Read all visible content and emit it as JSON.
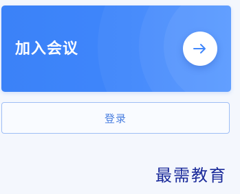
{
  "join_card": {
    "title": "加入会议",
    "arrow_icon": "arrow-right-icon",
    "colors": {
      "background": "#3f86fb",
      "text": "#ffffff"
    }
  },
  "login": {
    "label": "登录",
    "colors": {
      "border": "#9dbdf5",
      "text": "#4a7fe0"
    }
  },
  "watermark": {
    "text": "最需教育",
    "color": "#1a2a9a"
  }
}
